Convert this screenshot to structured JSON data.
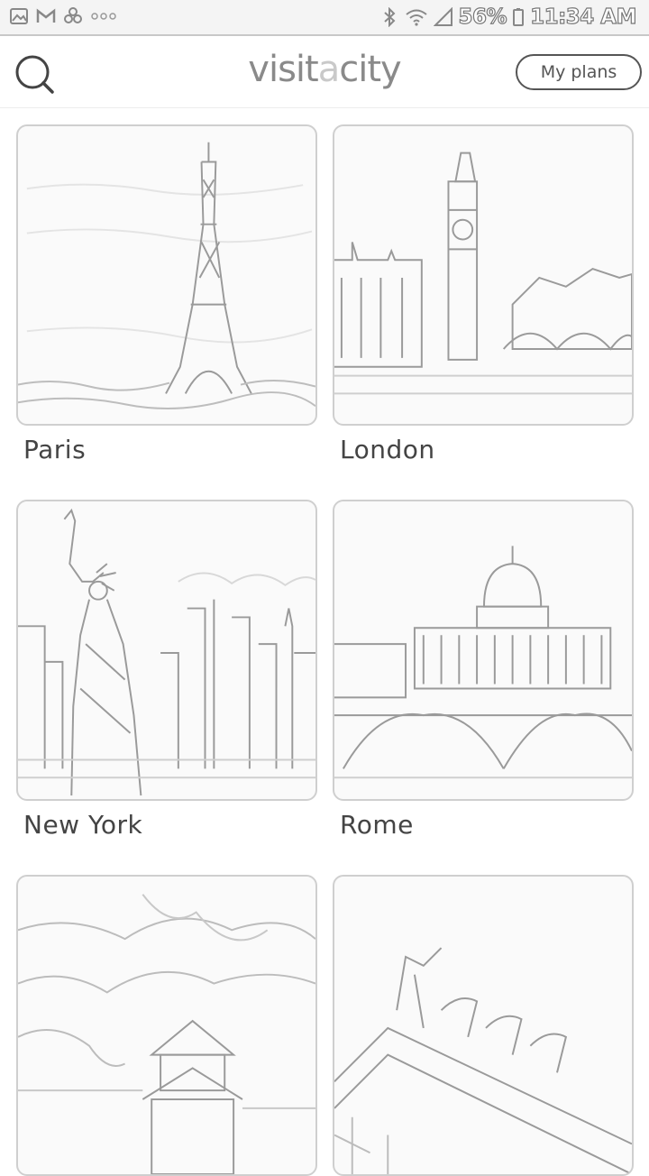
{
  "status_bar": {
    "left_icons": [
      "image-icon",
      "gmail-icon",
      "pinwheel-icon",
      "more-dots-icon"
    ],
    "right_icons": [
      "bluetooth-icon",
      "wifi-icon",
      "signal-icon"
    ],
    "battery": "56%",
    "time": "11:34 AM"
  },
  "header": {
    "logo_main": "visit",
    "logo_accent": "a",
    "logo_end": "city",
    "plans_label": "My plans",
    "search_icon": "search-icon"
  },
  "cities": [
    {
      "name": "Paris",
      "image": "eiffel-tower-image"
    },
    {
      "name": "London",
      "image": "big-ben-image"
    },
    {
      "name": "New York",
      "image": "statue-of-liberty-image"
    },
    {
      "name": "Rome",
      "image": "st-peters-basilica-image"
    },
    {
      "name": "",
      "image": "pagoda-garden-image"
    },
    {
      "name": "",
      "image": "quadriga-image"
    }
  ]
}
